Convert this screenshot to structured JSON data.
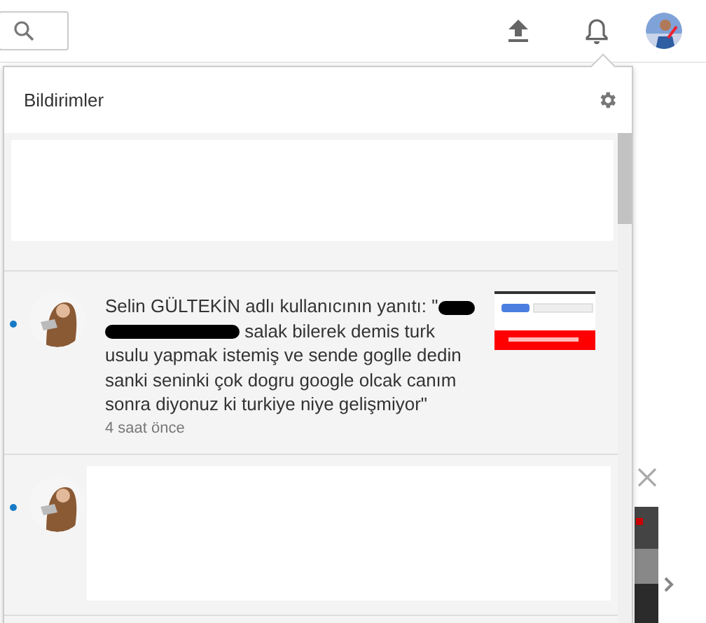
{
  "panel": {
    "title": "Bildirimler"
  },
  "notifications": [
    {
      "kind": "blank"
    },
    {
      "kind": "comment",
      "unread": true,
      "text_before": "Selin GÜLTEKİN adlı kullanıcının yanıtı: \"",
      "text_after": " salak bilerek demis turk usulu yapmak istemiş ve sende goglle dedin sanki seninki çok dogru google olcak canım sonra diyonuz ki turkiye niye gelişmiyor\"",
      "time": "4 saat önce",
      "redacted": true
    },
    {
      "kind": "loading",
      "unread": true
    }
  ]
}
